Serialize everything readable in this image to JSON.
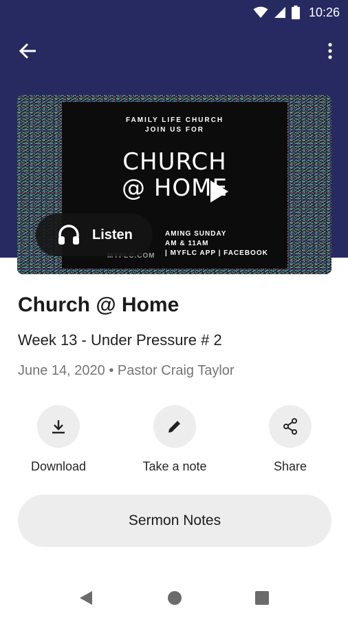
{
  "status_bar": {
    "time": "10:26"
  },
  "hero": {
    "poster_line1": "FAMILY LIFE CHURCH",
    "poster_line2": "JOIN US FOR",
    "poster_title_line1": "CHURCH",
    "poster_title_line2": "@ HOME",
    "poster_info_line1": "AMING SUNDAY",
    "poster_info_line2": "AM & 11AM",
    "poster_info_line3": "| MYFLC APP | FACEBOOK",
    "poster_site": "MYFLC.COM",
    "listen_label": "Listen"
  },
  "sermon": {
    "title": "Church @ Home",
    "subtitle": "Week 13 - Under Pressure # 2",
    "meta": "June 14, 2020 • Pastor Craig Taylor"
  },
  "actions": {
    "download_label": "Download",
    "note_label": "Take a note",
    "share_label": "Share"
  },
  "notes_button": "Sermon Notes",
  "colors": {
    "header": "#272a61",
    "button_bg": "#ededed"
  },
  "icons": [
    "wifi-icon",
    "signal-icon",
    "battery-icon",
    "back-arrow-icon",
    "more-vert-icon",
    "play-icon",
    "headphones-icon",
    "download-icon",
    "pencil-icon",
    "share-icon",
    "nav-back-icon",
    "nav-home-icon",
    "nav-recents-icon"
  ]
}
